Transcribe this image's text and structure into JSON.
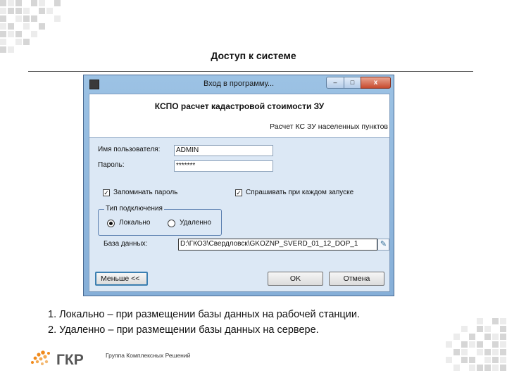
{
  "slide": {
    "title": "Доступ к системе",
    "notes": [
      "1. Локально – при размещении базы данных на рабочей станции.",
      "2. Удаленно – при размещении базы данных на сервере."
    ]
  },
  "dialog": {
    "title": "Вход в программу...",
    "controls": {
      "minimize": "–",
      "maximize": "□",
      "close": "x"
    },
    "banner_title": "КСПО расчет кадастровой стоимости ЗУ",
    "banner_subtitle": "Расчет КС ЗУ населенных пунктов",
    "username_label": "Имя пользователя:",
    "username_value": "ADMIN",
    "password_label": "Пароль:",
    "password_value": "*******",
    "remember_label": "Запоминать пароль",
    "remember_checked": true,
    "ask_label": "Спрашивать при каждом запуске",
    "ask_checked": true,
    "connection_legend": "Тип подключения",
    "option_local": "Локально",
    "option_remote": "Удаленно",
    "selected_option": "local",
    "db_label": "База данных:",
    "db_value": "D:\\ГКОЗ\\Свердловск\\GKOZNP_SVERD_01_12_DOP_1",
    "less_button": "Меньше <<",
    "ok_button": "OK",
    "cancel_button": "Отмена"
  },
  "logo": {
    "brand": "ГКР",
    "subtitle": "Группа Комплексных Решений",
    "colors": {
      "orange": "#f08a1c",
      "gray": "#555555"
    }
  }
}
